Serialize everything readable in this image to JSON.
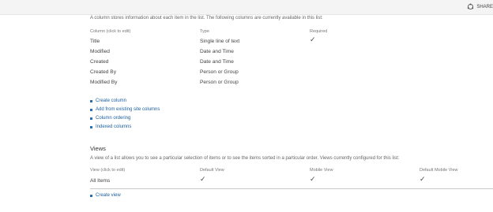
{
  "topbar": {
    "share_label": "SHARE"
  },
  "columns_section": {
    "description": "A column stores information about each item in the list. The following columns are currently available in this list:",
    "headers": {
      "column": "Column (click to edit)",
      "type": "Type",
      "required": "Required"
    },
    "rows": [
      {
        "name": "Title",
        "type": "Single line of text",
        "required": true
      },
      {
        "name": "Modified",
        "type": "Date and Time",
        "required": false
      },
      {
        "name": "Created",
        "type": "Date and Time",
        "required": false
      },
      {
        "name": "Created By",
        "type": "Person or Group",
        "required": false
      },
      {
        "name": "Modified By",
        "type": "Person or Group",
        "required": false
      }
    ],
    "links": [
      "Create column",
      "Add from existing site columns",
      "Column ordering",
      "Indexed columns"
    ]
  },
  "views_section": {
    "title": "Views",
    "description": "A view of a list allows you to see a particular selection of items or to see the items sorted in a particular order. Views currently configured for this list:",
    "headers": {
      "view": "View (click to edit)",
      "default_view": "Default View",
      "mobile_view": "Mobile View",
      "default_mobile_view": "Default Mobile View"
    },
    "rows": [
      {
        "name": "All Items",
        "default_view": true,
        "mobile_view": true,
        "default_mobile_view": true
      }
    ],
    "links": [
      "Create view"
    ]
  },
  "icons": {
    "check": "checkmark-icon",
    "share": "share-icon",
    "bullet": "bullet-icon"
  },
  "colors": {
    "link": "#1a5e9f",
    "bullet": "#2a6db5",
    "text": "#444444"
  }
}
